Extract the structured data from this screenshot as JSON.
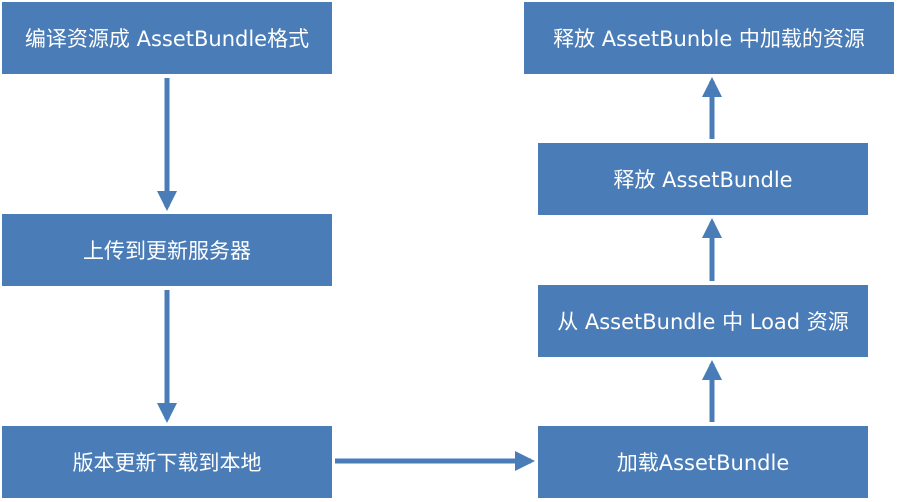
{
  "nodes": {
    "compile": "编译资源成 AssetBundle格式",
    "upload": "上传到更新服务器",
    "download": "版本更新下载到本地",
    "load_bundle": "加载AssetBundle",
    "load_resource": "从 AssetBundle 中 Load 资源",
    "release_bundle": "释放 AssetBundle",
    "release_resource": "释放 AssetBunble 中加载的资源"
  },
  "colors": {
    "node_fill": "#4a7cb7",
    "node_text": "#ffffff",
    "arrow": "#4a7cb7"
  }
}
